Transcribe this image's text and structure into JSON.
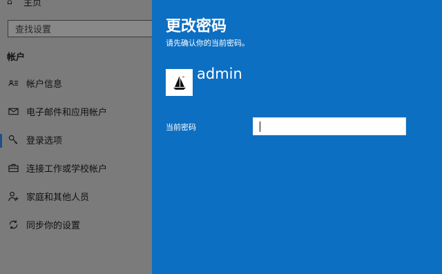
{
  "sidebar": {
    "home_label": "主页",
    "search_placeholder": "查找设置",
    "section_title": "帐户",
    "items": [
      {
        "label": "帐户信息",
        "icon": "person-card-icon"
      },
      {
        "label": "电子邮件和应用帐户",
        "icon": "mail-icon"
      },
      {
        "label": "登录选项",
        "icon": "key-icon"
      },
      {
        "label": "连接工作或学校帐户",
        "icon": "briefcase-icon"
      },
      {
        "label": "家庭和其他人员",
        "icon": "person-add-icon"
      },
      {
        "label": "同步你的设置",
        "icon": "sync-icon"
      }
    ],
    "selected_index": 2
  },
  "dialog": {
    "title": "更改密码",
    "subtitle": "请先确认你的当前密码。",
    "username": "admin",
    "avatar_icon": "sailboat-icon",
    "current_password_label": "当前密码",
    "current_password_value": ""
  },
  "colors": {
    "dialog_bg": "#0d6fc2",
    "overlay_dim": "#7b7b7b"
  }
}
